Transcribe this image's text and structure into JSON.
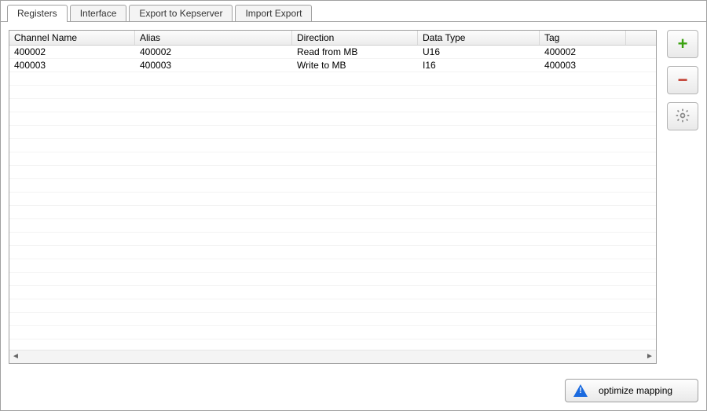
{
  "tabs": [
    {
      "label": "Registers",
      "active": true
    },
    {
      "label": "Interface",
      "active": false
    },
    {
      "label": "Export to Kepserver",
      "active": false
    },
    {
      "label": "Import Export",
      "active": false
    }
  ],
  "columns": {
    "channel": "Channel Name",
    "alias": "Alias",
    "direction": "Direction",
    "datatype": "Data Type",
    "tag": "Tag"
  },
  "rows": [
    {
      "channel": "400002",
      "alias": "400002",
      "direction": "Read from MB",
      "datatype": "U16",
      "tag": "400002"
    },
    {
      "channel": "400003",
      "alias": "400003",
      "direction": "Write to MB",
      "datatype": "I16",
      "tag": "400003"
    }
  ],
  "buttons": {
    "optimize": "optimize mapping"
  }
}
